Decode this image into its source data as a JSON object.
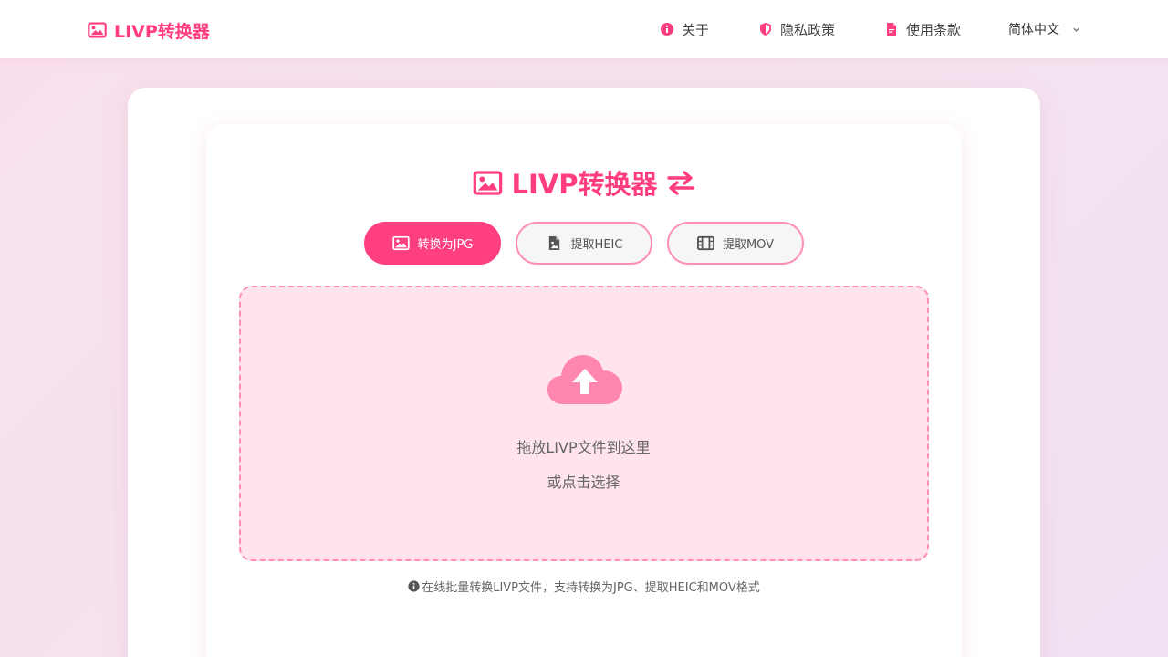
{
  "header": {
    "brand": "LIVP转换器",
    "nav": [
      {
        "label": "关于",
        "icon": "info-circle-icon"
      },
      {
        "label": "隐私政策",
        "icon": "shield-icon"
      },
      {
        "label": "使用条款",
        "icon": "document-icon"
      }
    ],
    "language": "简体中文"
  },
  "main": {
    "title": "LIVP转换器",
    "tabs": [
      {
        "label": "转换为JPG",
        "icon": "image-icon",
        "active": true
      },
      {
        "label": "提取HEIC",
        "icon": "file-image-icon",
        "active": false
      },
      {
        "label": "提取MOV",
        "icon": "film-icon",
        "active": false
      }
    ],
    "dropzone": {
      "primary": "拖放LIVP文件到这里",
      "secondary": "或点击选择"
    },
    "info": "在线批量转换LIVP文件，支持转换为JPG、提取HEIC和MOV格式"
  },
  "colors": {
    "accent": "#ff3d7f",
    "accent_light": "#ff8fb5",
    "dropzone_bg": "#ffe4ef"
  }
}
